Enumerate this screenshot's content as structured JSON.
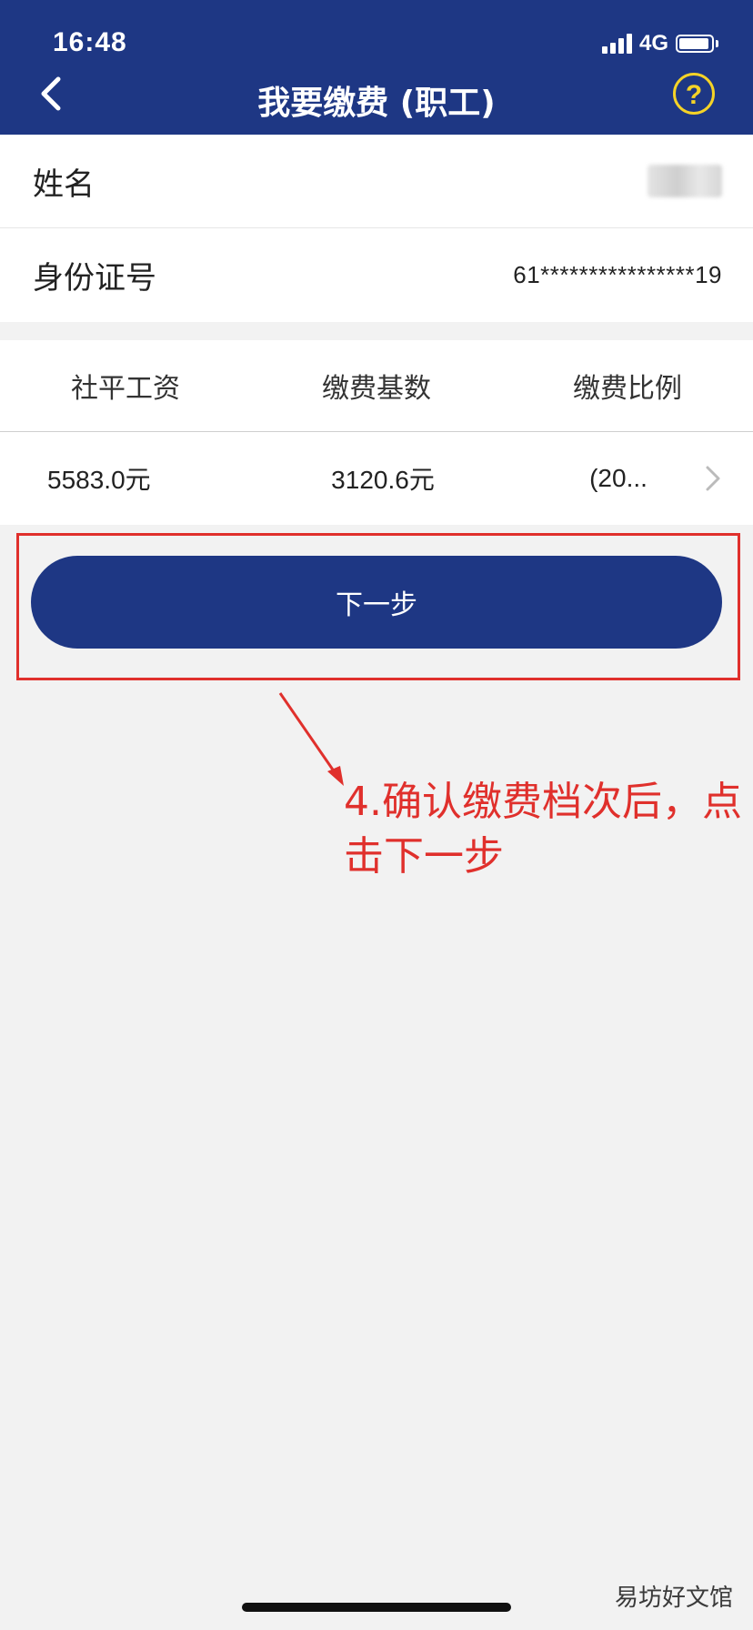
{
  "status_bar": {
    "time": "16:48",
    "network": "4G"
  },
  "header": {
    "title": "我要缴费 (职工)",
    "help_symbol": "?"
  },
  "info": {
    "name_label": "姓名",
    "id_label": "身份证号",
    "id_value": "61****************19"
  },
  "table": {
    "headers": [
      "社平工资",
      "缴费基数",
      "缴费比例"
    ],
    "row": [
      "5583.0元",
      "3120.6元",
      "(20..."
    ]
  },
  "next_button_label": "下一步",
  "annotation": {
    "line1": "4.确认缴费档次后，点",
    "line2": "击下一步"
  },
  "watermark": "易坊好文馆",
  "colors": {
    "primary": "#1e3784",
    "accent": "#e0302c",
    "help": "#f5d327"
  }
}
